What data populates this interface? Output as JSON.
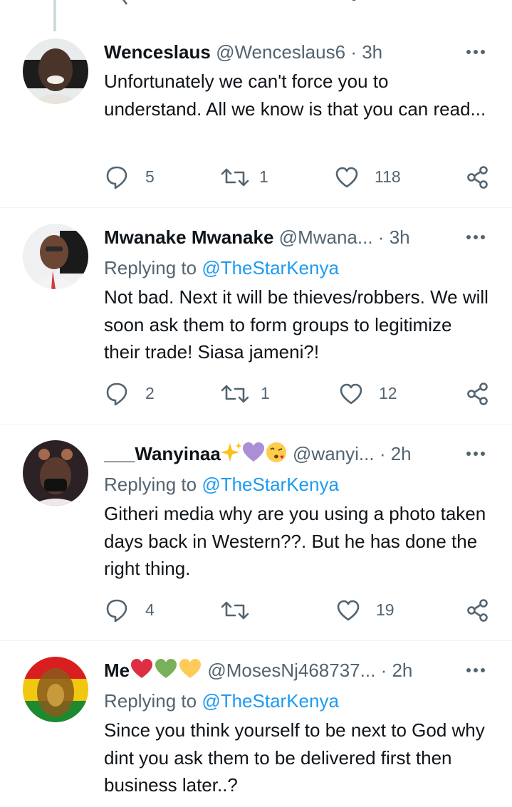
{
  "top_partial": {
    "reply_count": "",
    "retweet_count": "",
    "like_count": ""
  },
  "tweets": [
    {
      "name": "Wenceslaus",
      "handle": "@Wenceslaus6",
      "dot": "·",
      "time": "3h",
      "replying_prefix": "",
      "replying_to": "",
      "text": "Unfortunately we can't force you to understand. All we know is that you can read...",
      "replies": "5",
      "retweets": "1",
      "likes": "118"
    },
    {
      "name": "Mwanake Mwanake",
      "handle": "@Mwana...",
      "dot": "·",
      "time": "3h",
      "replying_prefix": "Replying to",
      "replying_to": "@TheStarKenya",
      "text": "Not bad. Next it will be thieves/robbers. We will soon ask them to form groups to legitimize their trade! Siasa jameni?!",
      "replies": "2",
      "retweets": "1",
      "likes": "12"
    },
    {
      "name": "___Wanyinaa",
      "name_emojis": [
        "sparkles-emoji",
        "purple-heart-emoji",
        "kissing-face-emoji"
      ],
      "handle": "@wanyi...",
      "dot": "·",
      "time": "2h",
      "replying_prefix": "Replying to",
      "replying_to": "@TheStarKenya",
      "text": "Githeri media why are you using a photo taken days back in Western??. But he has done the right thing.",
      "replies": "4",
      "retweets": "",
      "likes": "19"
    },
    {
      "name": "Me",
      "name_emojis": [
        "red-heart-emoji",
        "green-heart-emoji",
        "yellow-heart-emoji"
      ],
      "handle": "@MosesNj468737...",
      "dot": "·",
      "time": "2h",
      "replying_prefix": "Replying to",
      "replying_to": "@TheStarKenya",
      "text": "Since you think yourself to be next to God why dint you ask them to be delivered first then business later..?"
    }
  ],
  "colors": {
    "text": "#0f1419",
    "secondary": "#536471",
    "link": "#1d9bf0",
    "divider": "#eff3f4"
  }
}
